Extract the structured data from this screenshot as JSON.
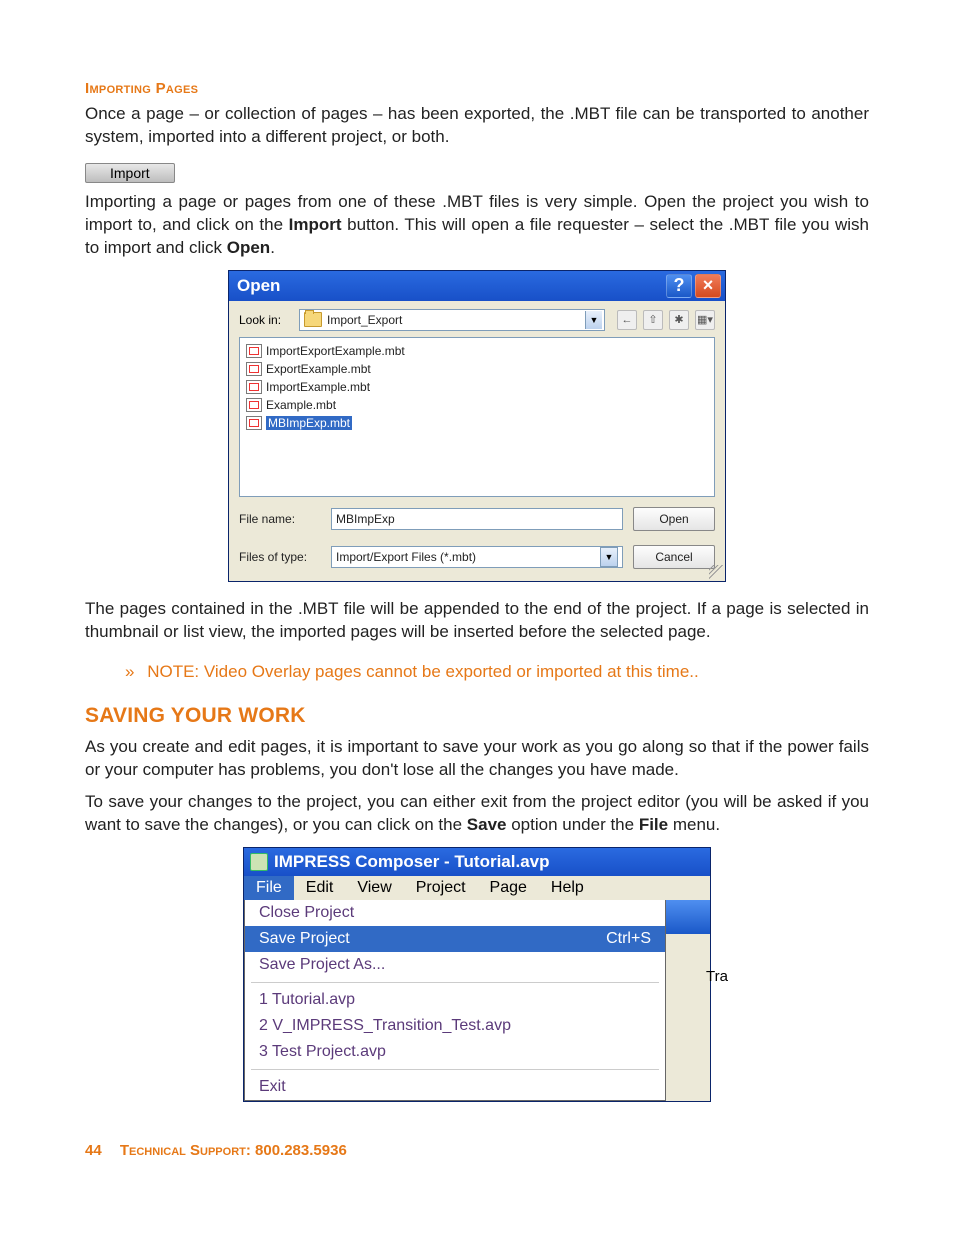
{
  "labels": {
    "importing_pages": "Importing Pages",
    "saving_heading": "SAVING YOUR WORK"
  },
  "paragraphs": {
    "p1": "Once a page – or collection of pages – has been exported, the .MBT file can be transported to another system, imported into a different project, or both.",
    "p2a": "Importing a page or pages from one of these .MBT files is very simple. Open the project you wish to import to, and click on the ",
    "p2_bold1": "Import",
    "p2b": " button. This will open a file requester – select the .MBT file you wish to import and click ",
    "p2_bold2": "Open",
    "p2c": ".",
    "p3": "The pages contained in the .MBT file will be appended to the end of the project. If a page is selected in thumbnail or list view, the imported pages will be inserted before the selected page.",
    "note": "NOTE: Video Overlay pages cannot be exported or imported at this time..",
    "p4": "As you create and edit pages, it is important to save your work as you go along so that if the power fails or your computer has problems, you don't lose all the changes you have made.",
    "p5a": "To save your changes to the project, you can either exit from the project editor (you will be asked if you want to save the changes), or you can click on the ",
    "p5_bold1": "Save",
    "p5b": " option under the ",
    "p5_bold2": "File",
    "p5c": " menu."
  },
  "import_button": "Import",
  "open_dialog": {
    "title": "Open",
    "lookin_label": "Look in:",
    "lookin_value": "Import_Export",
    "files": [
      "ImportExportExample.mbt",
      "ExportExample.mbt",
      "ImportExample.mbt",
      "Example.mbt",
      "MBImpExp.mbt"
    ],
    "filename_label": "File name:",
    "filename_value": "MBImpExp",
    "filetype_label": "Files of type:",
    "filetype_value": "Import/Export Files (*.mbt)",
    "open_btn": "Open",
    "cancel_btn": "Cancel"
  },
  "composer": {
    "title": "IMPRESS Composer - Tutorial.avp",
    "menus": [
      "File",
      "Edit",
      "View",
      "Project",
      "Page",
      "Help"
    ],
    "items": {
      "close": "Close Project",
      "save": "Save Project",
      "save_shortcut": "Ctrl+S",
      "saveas": "Save Project As...",
      "recent1": "1 Tutorial.avp",
      "recent2": "2 V_IMPRESS_Transition_Test.avp",
      "recent3": "3 Test Project.avp",
      "exit": "Exit"
    },
    "right_snip": "Tra"
  },
  "footer": {
    "page": "44",
    "support": "Technical Support: 800.283.5936"
  }
}
